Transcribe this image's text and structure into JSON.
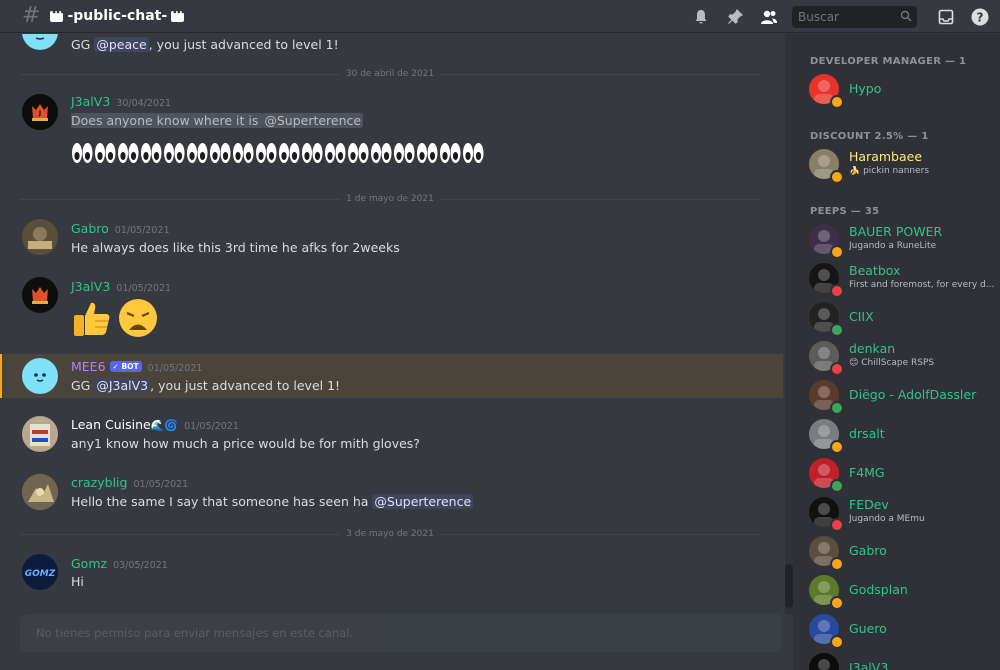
{
  "channel": {
    "name": "-public-chat-"
  },
  "search": {
    "placeholder": "Buscar"
  },
  "messages": {
    "mee6_top": {
      "text_pre": "GG ",
      "mention": "@peace",
      "text_post": ", you just advanced to level 1!"
    },
    "div1": "30 de abril de 2021",
    "m1": {
      "user": "J3alV3",
      "time": "30/04/2021",
      "text": "Does anyone know where it is ",
      "mention": "@Superterence",
      "emoji_count": 18
    },
    "div2": "1 de mayo de 2021",
    "m2": {
      "user": "Gabro",
      "time": "01/05/2021",
      "text": "He always does like this 3rd time he afks for 2weeks"
    },
    "m3": {
      "user": "J3alV3",
      "time": "01/05/2021"
    },
    "m4": {
      "user": "MEE6",
      "bot": "✓ BOT",
      "time": "01/05/2021",
      "text_pre": "GG ",
      "mention": "@J3alV3",
      "text_post": ", you just advanced to level 1!"
    },
    "m5": {
      "user": "Lean Cuisine",
      "time": "01/05/2021",
      "text": "any1 know how much a price would be for mith gloves?"
    },
    "m6": {
      "user": "crazyblig",
      "time": "01/05/2021",
      "text": "Hello the same I say that someone has seen ha ",
      "mention": "@Superterence"
    },
    "div3": "3 de mayo de 2021",
    "m7": {
      "user": "Gomz",
      "time": "03/05/2021",
      "text": "Hi"
    }
  },
  "input": {
    "placeholder": "No tienes permiso para enviar mensajes en este canal."
  },
  "members": {
    "groups": [
      {
        "title": "DEVELOPER MANAGER — 1"
      },
      {
        "title": "DISCOUNT 2.5% — 1"
      },
      {
        "title": "PEEPS — 35"
      }
    ],
    "list": [
      {
        "name": "Hypo",
        "activity": ""
      },
      {
        "name": "Harambaee",
        "activity": "🍌 pickin nanners"
      },
      {
        "name": "BAUER POWER",
        "activity": "Jugando a RuneLite"
      },
      {
        "name": "Beatbox",
        "activity": "First and foremost, for every d..."
      },
      {
        "name": "CIIX",
        "activity": ""
      },
      {
        "name": "denkan",
        "activity": "😊 ChillScape RSPS"
      },
      {
        "name": "Diëgo - AdolfDassler",
        "activity": ""
      },
      {
        "name": "drsalt",
        "activity": ""
      },
      {
        "name": "F4MG",
        "activity": ""
      },
      {
        "name": "FEDev",
        "activity": "Jugando a MEmu"
      },
      {
        "name": "Gabro",
        "activity": ""
      },
      {
        "name": "Godsplan",
        "activity": ""
      },
      {
        "name": "Guero",
        "activity": ""
      },
      {
        "name": "J3alV3",
        "activity": ""
      }
    ]
  },
  "colors": {
    "green": "#3ba55d",
    "yellow": "#faa61a",
    "red": "#ed4245",
    "teal_name": "#2fc48c",
    "harambaee": "#fcec7d",
    "mee6": "#b981f2"
  }
}
